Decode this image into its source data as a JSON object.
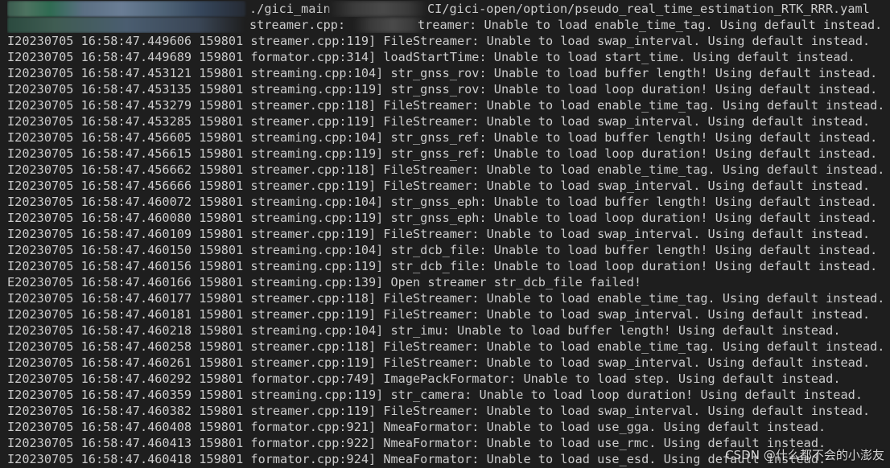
{
  "terminal": {
    "command_line": {
      "part1": "./gici_main",
      "part2": "CI/gici-open/option/pseudo_real_time_estimation_RTK_RRR.yaml"
    },
    "first_line_partial": {
      "left": "streamer.cpp:",
      "right": "treamer: Unable to load enable_time_tag. Using default instead."
    },
    "log_lines": [
      "I20230705 16:58:47.449606 159801 streamer.cpp:119] FileStreamer: Unable to load swap_interval. Using default instead.",
      "I20230705 16:58:47.449689 159801 formator.cpp:314] loadStartTime: Unable to load start_time. Using default instead.",
      "I20230705 16:58:47.453121 159801 streaming.cpp:104] str_gnss_rov: Unable to load buffer length! Using default instead.",
      "I20230705 16:58:47.453135 159801 streaming.cpp:119] str_gnss_rov: Unable to load loop duration! Using default instead.",
      "I20230705 16:58:47.453279 159801 streamer.cpp:118] FileStreamer: Unable to load enable_time_tag. Using default instead.",
      "I20230705 16:58:47.453285 159801 streamer.cpp:119] FileStreamer: Unable to load swap_interval. Using default instead.",
      "I20230705 16:58:47.456605 159801 streaming.cpp:104] str_gnss_ref: Unable to load buffer length! Using default instead.",
      "I20230705 16:58:47.456615 159801 streaming.cpp:119] str_gnss_ref: Unable to load loop duration! Using default instead.",
      "I20230705 16:58:47.456662 159801 streamer.cpp:118] FileStreamer: Unable to load enable_time_tag. Using default instead.",
      "I20230705 16:58:47.456666 159801 streamer.cpp:119] FileStreamer: Unable to load swap_interval. Using default instead.",
      "I20230705 16:58:47.460072 159801 streaming.cpp:104] str_gnss_eph: Unable to load buffer length! Using default instead.",
      "I20230705 16:58:47.460080 159801 streaming.cpp:119] str_gnss_eph: Unable to load loop duration! Using default instead.",
      "I20230705 16:58:47.460109 159801 streamer.cpp:119] FileStreamer: Unable to load swap_interval. Using default instead.",
      "I20230705 16:58:47.460150 159801 streaming.cpp:104] str_dcb_file: Unable to load buffer length! Using default instead.",
      "I20230705 16:58:47.460156 159801 streaming.cpp:119] str_dcb_file: Unable to load loop duration! Using default instead.",
      "E20230705 16:58:47.460166 159801 streaming.cpp:139] Open streamer str_dcb_file failed!",
      "I20230705 16:58:47.460177 159801 streamer.cpp:118] FileStreamer: Unable to load enable_time_tag. Using default instead.",
      "I20230705 16:58:47.460181 159801 streamer.cpp:119] FileStreamer: Unable to load swap_interval. Using default instead.",
      "I20230705 16:58:47.460218 159801 streaming.cpp:104] str_imu: Unable to load buffer length! Using default instead.",
      "I20230705 16:58:47.460258 159801 streamer.cpp:118] FileStreamer: Unable to load enable_time_tag. Using default instead.",
      "I20230705 16:58:47.460261 159801 streamer.cpp:119] FileStreamer: Unable to load swap_interval. Using default instead.",
      "I20230705 16:58:47.460292 159801 formator.cpp:749] ImagePackFormator: Unable to load step. Using default instead.",
      "I20230705 16:58:47.460359 159801 streaming.cpp:119] str_camera: Unable to load loop duration! Using default instead.",
      "I20230705 16:58:47.460382 159801 streamer.cpp:119] FileStreamer: Unable to load swap_interval. Using default instead.",
      "I20230705 16:58:47.460408 159801 formator.cpp:921] NmeaFormator: Unable to load use_gga. Using default instead.",
      "I20230705 16:58:47.460413 159801 formator.cpp:922] NmeaFormator: Unable to load use_rmc. Using default instead.",
      "I20230705 16:58:47.460418 159801 formator.cpp:924] NmeaFormator: Unable to load use_esd. Using default instead."
    ]
  },
  "watermark": "CSDN @什么都不会的小澎友",
  "colors": {
    "background": "#1e1e1e",
    "text": "#cccccc"
  }
}
